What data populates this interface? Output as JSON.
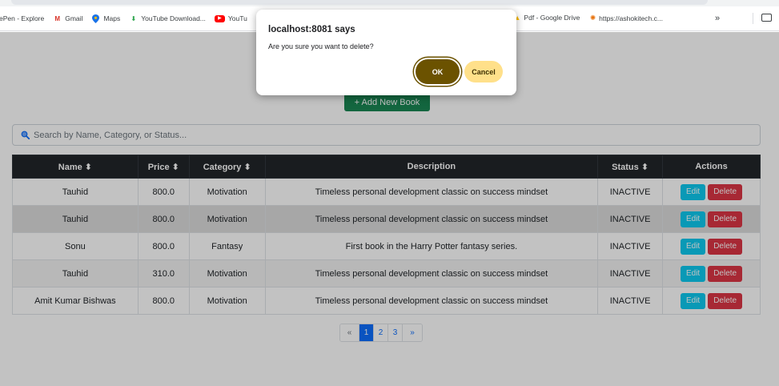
{
  "bookmarks": {
    "items": [
      {
        "label": "ePen - Explore"
      },
      {
        "label": "Gmail"
      },
      {
        "label": "Maps"
      },
      {
        "label": "YouTube Download..."
      },
      {
        "label": "YouTu"
      }
    ],
    "right_items": [
      {
        "label": "Pdf - Google Drive"
      },
      {
        "label": "https://ashokitech.c..."
      }
    ],
    "overflow": "»"
  },
  "page": {
    "add_button": "+ Add New Book",
    "search_placeholder": "Search by Name, Category, or Status...",
    "table": {
      "headers": [
        "Name ⬍",
        "Price ⬍",
        "Category ⬍",
        "Description",
        "Status ⬍",
        "Actions"
      ],
      "rows": [
        {
          "name": "Tauhid",
          "price": "800.0",
          "category": "Motivation",
          "description": "Timeless personal development classic on success mindset",
          "status": "INACTIVE"
        },
        {
          "name": "Tauhid",
          "price": "800.0",
          "category": "Motivation",
          "description": "Timeless personal development classic on success mindset",
          "status": "INACTIVE"
        },
        {
          "name": "Sonu",
          "price": "800.0",
          "category": "Fantasy",
          "description": "First book in the Harry Potter fantasy series.",
          "status": "INACTIVE"
        },
        {
          "name": "Tauhid",
          "price": "310.0",
          "category": "Motivation",
          "description": "Timeless personal development classic on success mindset",
          "status": "INACTIVE"
        },
        {
          "name": "Amit Kumar Bishwas",
          "price": "800.0",
          "category": "Motivation",
          "description": "Timeless personal development classic on success mindset",
          "status": "INACTIVE"
        }
      ],
      "edit_label": "Edit",
      "delete_label": "Delete"
    },
    "pagination": {
      "prev": "«",
      "pages": [
        "1",
        "2",
        "3"
      ],
      "next": "»",
      "current": "1"
    }
  },
  "dialog": {
    "title": "localhost:8081 says",
    "message": "Are you sure you want to delete?",
    "ok_label": "OK",
    "cancel_label": "Cancel"
  },
  "colors": {
    "add_button": "#198754",
    "table_header": "#212529",
    "edit": "#0dcaf0",
    "delete": "#dc3545",
    "ok_button": "#6b5200",
    "cancel_button": "#ffe08a"
  }
}
